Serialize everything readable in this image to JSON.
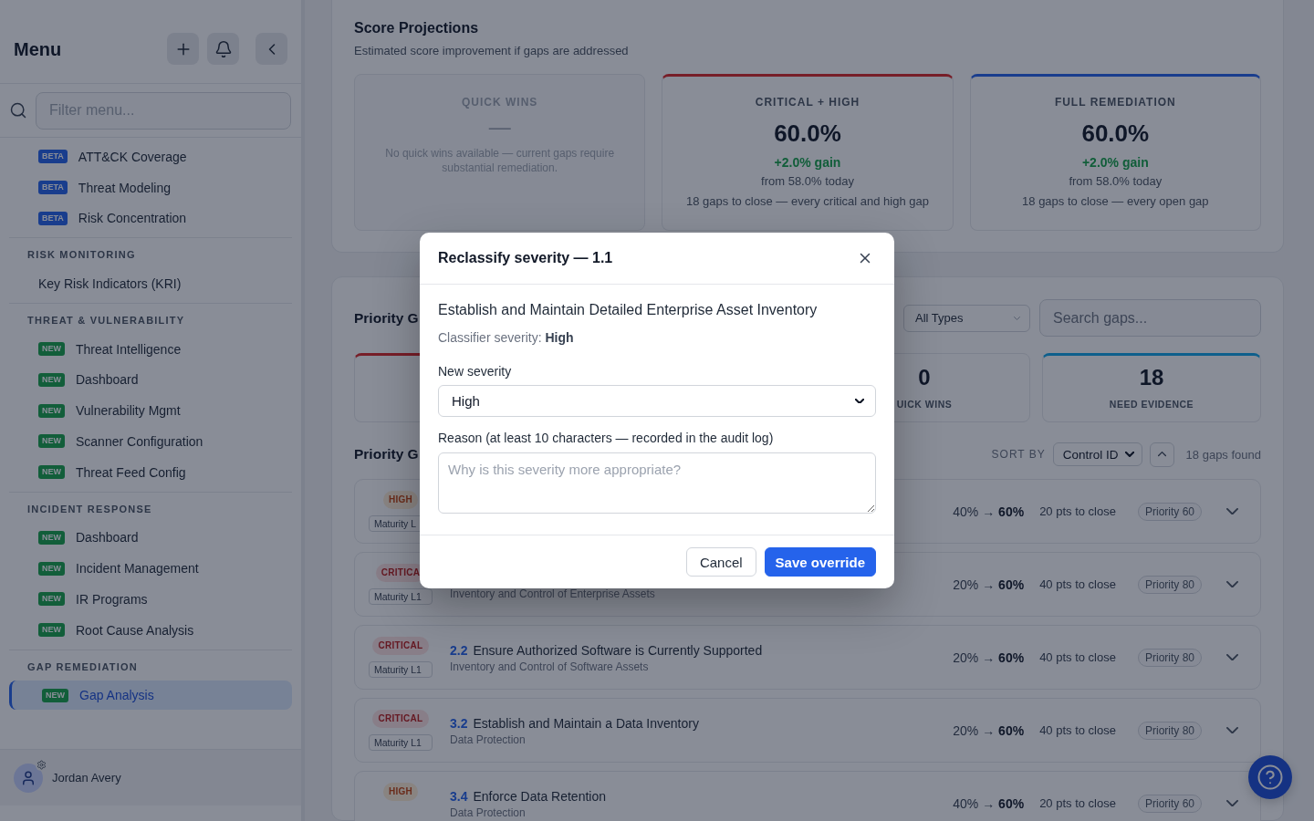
{
  "sidebar": {
    "title": "Menu",
    "filter": {
      "placeholder": "Filter menu..."
    },
    "sections": [
      {
        "items": [
          {
            "label": "ATT&CK Coverage",
            "badge": {
              "text": "BETA",
              "kind": "beta"
            },
            "selected": false
          },
          {
            "label": "Threat Modeling",
            "badge": {
              "text": "BETA",
              "kind": "beta"
            },
            "selected": false
          },
          {
            "label": "Risk Concentration",
            "badge": {
              "text": "BETA",
              "kind": "beta"
            },
            "selected": false
          }
        ]
      },
      {
        "heading": "RISK MONITORING",
        "items": [
          {
            "label": "Key Risk Indicators (KRI)",
            "selected": false
          }
        ]
      },
      {
        "heading": "THREAT & VULNERABILITY",
        "items": [
          {
            "label": "Threat Intelligence",
            "badge": {
              "text": "NEW",
              "kind": "new"
            },
            "selected": false
          },
          {
            "label": "Dashboard",
            "badge": {
              "text": "NEW",
              "kind": "new"
            },
            "selected": false
          },
          {
            "label": "Vulnerability Mgmt",
            "badge": {
              "text": "NEW",
              "kind": "new"
            },
            "selected": false
          },
          {
            "label": "Scanner Configuration",
            "badge": {
              "text": "NEW",
              "kind": "new"
            },
            "selected": false
          },
          {
            "label": "Threat Feed Config",
            "badge": {
              "text": "NEW",
              "kind": "new"
            },
            "selected": false
          }
        ]
      },
      {
        "heading": "INCIDENT RESPONSE",
        "items": [
          {
            "label": "Dashboard",
            "badge": {
              "text": "NEW",
              "kind": "new"
            },
            "selected": false
          },
          {
            "label": "Incident Management",
            "badge": {
              "text": "NEW",
              "kind": "new"
            },
            "selected": false
          },
          {
            "label": "IR Programs",
            "badge": {
              "text": "NEW",
              "kind": "new"
            },
            "selected": false
          },
          {
            "label": "Root Cause Analysis",
            "badge": {
              "text": "NEW",
              "kind": "new"
            },
            "selected": false
          }
        ]
      },
      {
        "heading": "GAP REMEDIATION",
        "items": [
          {
            "label": "Gap Analysis",
            "badge": {
              "text": "NEW",
              "kind": "new"
            },
            "selected": true
          }
        ]
      }
    ],
    "user": {
      "name": "Jordan Avery"
    }
  },
  "score_projections": {
    "title": "Score Projections",
    "subtitle": "Estimated score improvement if gaps are addressed",
    "cards": [
      {
        "kind": "empty",
        "label": "QUICK WINS",
        "value": "—",
        "note": "No quick wins available — current gaps require substantial remediation."
      },
      {
        "kind": "critical",
        "label": "CRITICAL + HIGH",
        "value": "60.0%",
        "gain": "+2.0% gain",
        "baseline": "from 58.0% today",
        "note": "18 gaps to close — every critical and high gap"
      },
      {
        "kind": "full",
        "label": "FULL REMEDIATION",
        "value": "60.0%",
        "gain": "+2.0% gain",
        "baseline": "from 58.0% today",
        "note": "18 gaps to close — every open gap"
      }
    ]
  },
  "priority_gaps": {
    "title": "Priority G",
    "type_filter": {
      "value": "All Types"
    },
    "search": {
      "placeholder": "Search gaps..."
    },
    "stat_cards": [
      {
        "kind": "critical"
      },
      {
        "kind": "plain",
        "value": "0",
        "label": "UICK WINS"
      },
      {
        "kind": "evidence",
        "value": "18",
        "label": "NEED EVIDENCE"
      }
    ],
    "list_title": "Priority G",
    "sort_label": "SORT BY",
    "sort": {
      "value": "Control ID"
    },
    "count": "18 gaps found",
    "rows": [
      {
        "severity": {
          "text": "HIGH",
          "kind": "high"
        },
        "maturity": "Maturity L",
        "change": "40% → **60%**",
        "points": "20 pts to close",
        "priority": "Priority 60"
      },
      {
        "severity": {
          "text": "CRITICA",
          "kind": "critical"
        },
        "maturity": "Maturity L1",
        "category": "Inventory and Control of Enterprise Assets",
        "change": "20% → **60%**",
        "points": "40 pts to close",
        "priority": "Priority 80"
      },
      {
        "severity": {
          "text": "CRITICAL",
          "kind": "critical"
        },
        "maturity": "Maturity L1",
        "id": "2.2",
        "title": "Ensure Authorized Software is Currently Supported",
        "category": "Inventory and Control of Software Assets",
        "change": "20% → **60%**",
        "points": "40 pts to close",
        "priority": "Priority 80"
      },
      {
        "severity": {
          "text": "CRITICAL",
          "kind": "critical"
        },
        "maturity": "Maturity L1",
        "id": "3.2",
        "title": "Establish and Maintain a Data Inventory",
        "category": "Data Protection",
        "change": "20% → **60%**",
        "points": "40 pts to close",
        "priority": "Priority 80"
      },
      {
        "severity": {
          "text": "HIGH",
          "kind": "high"
        },
        "id": "3.4",
        "title": "Enforce Data Retention",
        "category": "Data Protection",
        "change": "40% → **60%**",
        "points": "20 pts to close",
        "priority": "Priority 60"
      }
    ]
  },
  "dialog": {
    "title": "Reclassify severity — 1.1",
    "control_title": "Establish and Maintain Detailed Enterprise Asset Inventory",
    "classifier": "Classifier severity: **High**",
    "severity_field": {
      "label": "New severity",
      "value": "High"
    },
    "reason_field": {
      "label": "Reason (at least 10 characters — recorded in the audit log)",
      "placeholder": "Why is this severity more appropriate?"
    },
    "buttons": [
      {
        "label": "Cancel",
        "kind": "cancel"
      },
      {
        "label": "Save override",
        "kind": "save"
      }
    ]
  }
}
